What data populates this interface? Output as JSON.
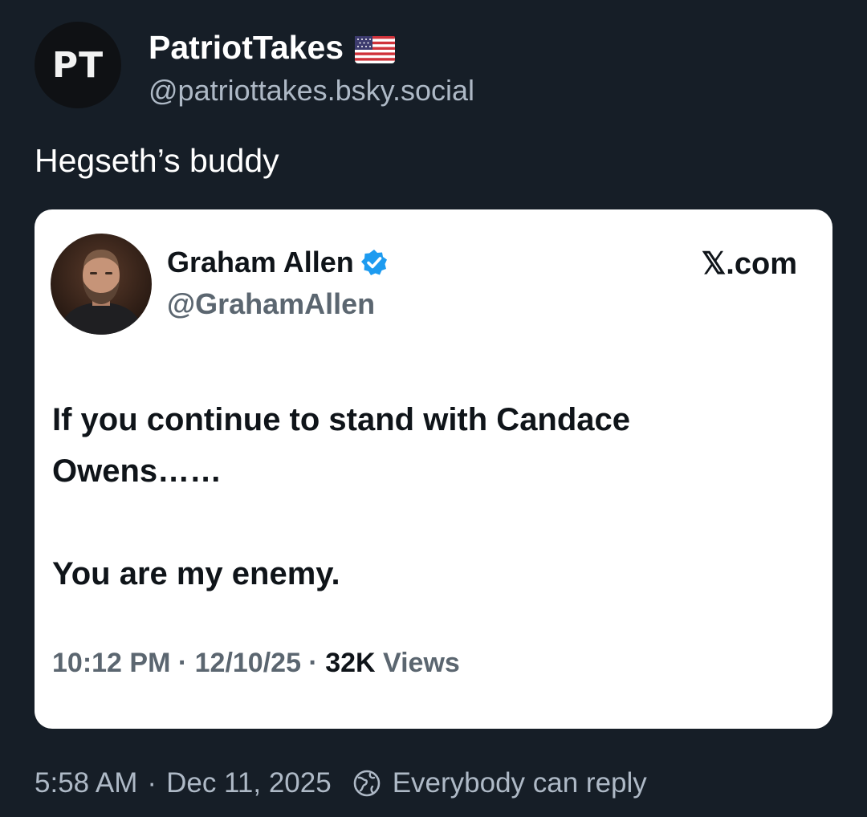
{
  "post": {
    "author": {
      "avatar_text": "PT",
      "display_name": "PatriotTakes",
      "flag_icon": "us-flag-icon",
      "handle": "@patriottakes.bsky.social"
    },
    "text": "Hegseth’s buddy",
    "footer": {
      "time": "5:58 AM",
      "separator": "·",
      "date": "Dec 11, 2025",
      "reply_icon": "globe-icon",
      "reply_setting": "Everybody can reply"
    }
  },
  "embed": {
    "author": {
      "display_name": "Graham Allen",
      "verified_icon": "verified-badge-icon",
      "handle": "@GrahamAllen"
    },
    "source": "𝕏.com",
    "body": {
      "line1": "If you continue to stand with Candace",
      "line2": "Owens……",
      "line3": "You are my enemy."
    },
    "meta": {
      "time": "10:12 PM",
      "sep1": " · ",
      "date": "12/10/25",
      "sep2": " · ",
      "views_count": "32K",
      "views_label": " Views"
    }
  },
  "colors": {
    "background": "#161e27",
    "muted_text": "#aeb9c6",
    "card_background": "#ffffff",
    "verified_blue": "#1d9bf0"
  }
}
